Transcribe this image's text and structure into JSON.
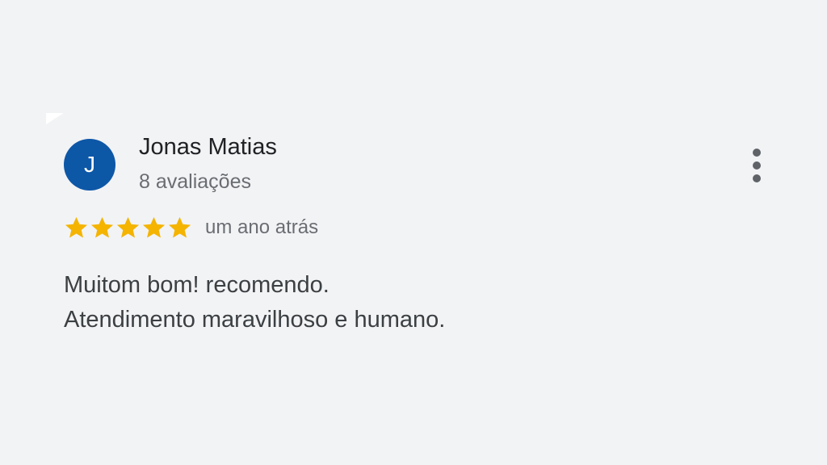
{
  "review": {
    "author": {
      "initial": "J",
      "name": "Jonas Matias",
      "review_count": "8 avaliações"
    },
    "rating": 5,
    "max_rating": 5,
    "date": "um ano atrás",
    "text_lines": [
      "Muitom bom! recomendo.",
      "Atendimento maravilhoso e humano."
    ]
  },
  "icons": {
    "menu": "more-vert-icon",
    "star": "star-icon"
  },
  "colors": {
    "background": "#f2f3f5",
    "avatar": "#0d57a7",
    "star": "#f4b400",
    "primary_text": "#202124",
    "secondary_text": "#6a6d72"
  }
}
